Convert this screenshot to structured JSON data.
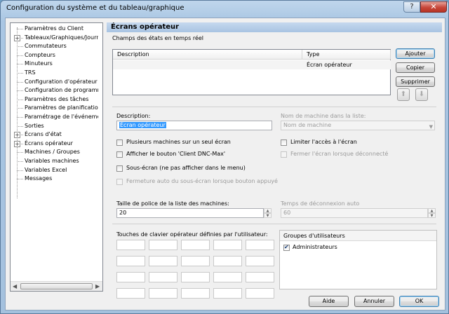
{
  "window": {
    "title": "Configuration du système et du tableau/graphique",
    "help_label": "?",
    "close_label": "✕"
  },
  "tree": {
    "items": [
      {
        "label": "Paramètres du Client",
        "expandable": false
      },
      {
        "label": "Tableaux/Graphiques/Journa",
        "expandable": true
      },
      {
        "label": "Commutateurs",
        "expandable": false
      },
      {
        "label": "Compteurs",
        "expandable": false
      },
      {
        "label": "Minuteurs",
        "expandable": false
      },
      {
        "label": "TRS",
        "expandable": false
      },
      {
        "label": "Configuration d'opérateur",
        "expandable": false
      },
      {
        "label": "Configuration de programme",
        "expandable": false
      },
      {
        "label": "Paramètres des tâches",
        "expandable": false
      },
      {
        "label": "Paramètres de planification",
        "expandable": false
      },
      {
        "label": "Paramétrage de l'événement",
        "expandable": false
      },
      {
        "label": "Sorties",
        "expandable": false
      },
      {
        "label": "Écrans d'état",
        "expandable": true
      },
      {
        "label": "Écrans opérateur",
        "expandable": true
      },
      {
        "label": "Machines / Groupes",
        "expandable": false
      },
      {
        "label": "Variables machines",
        "expandable": false
      },
      {
        "label": "Variables Excel",
        "expandable": false
      },
      {
        "label": "Messages",
        "expandable": false
      }
    ],
    "scroll_left": "◀",
    "scroll_right": "▶"
  },
  "panel": {
    "header": "Écrans opérateur",
    "realtime_fields_label": "Champs des états en temps réel",
    "grid": {
      "columns": [
        "Description",
        "Type"
      ],
      "rows": [
        [
          "",
          "Écran opérateur"
        ]
      ]
    },
    "buttons": {
      "add": "Ajouter",
      "copy": "Copier",
      "delete": "Supprimer",
      "up_icon": "⬆",
      "down_icon": "⬇"
    },
    "description_label": "Description:",
    "description_value": "Écran opérateur",
    "machine_name_label": "Nom de machine dans la liste:",
    "machine_name_value": "Nom de machine",
    "checkboxes": {
      "multi_machines": "Plusieurs machines sur un seul écran",
      "show_dnc_button": "Afficher le bouton 'Client DNC-Max'",
      "sub_screen": "Sous-écran (ne pas afficher dans le menu)",
      "auto_close": "Fermeture auto du sous-écran lorsque bouton appuyé",
      "limit_access": "Limiter l'accès à l'écran",
      "close_on_disconnect": "Fermer l'écran lorsque déconnecté"
    },
    "font_size_label": "Taille de police de la liste des machines:",
    "font_size_value": "20",
    "disconnect_label": "Temps de déconnexion auto",
    "disconnect_value": "60",
    "keys_label": "Touches de clavier opérateur définies par l'utilisateur:",
    "user_groups": {
      "header": "Groupes d'utilisateurs",
      "items": [
        {
          "label": "Administrateurs",
          "checked": true
        }
      ]
    }
  },
  "footer": {
    "help": "Aide",
    "cancel": "Annuler",
    "ok": "OK"
  }
}
